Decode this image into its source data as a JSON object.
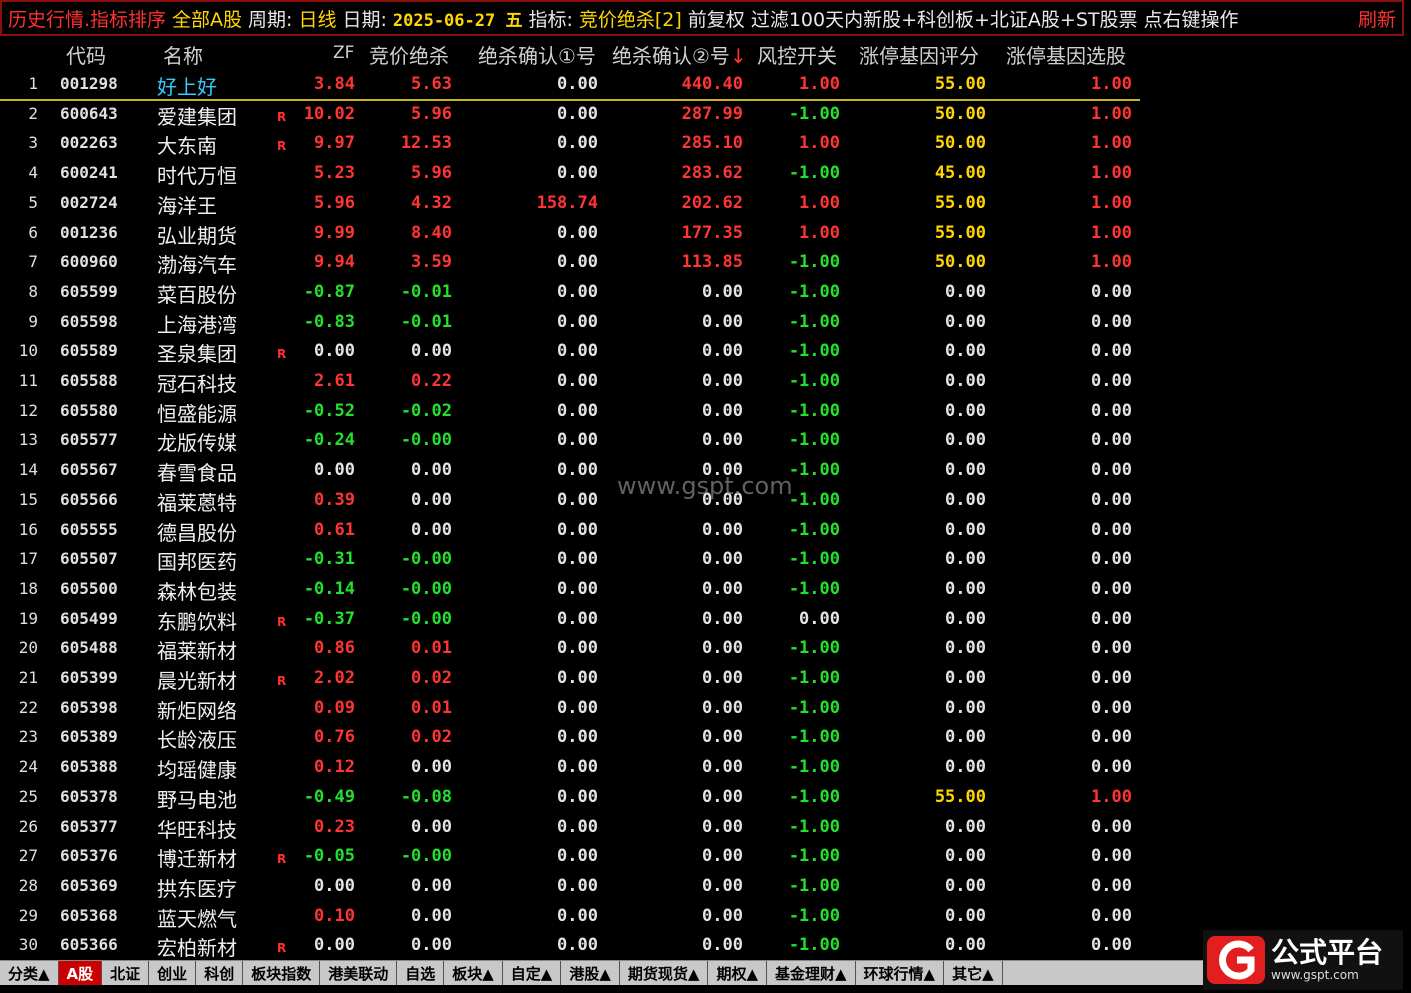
{
  "title": {
    "app": "历史行情.指标排序",
    "market": "全部A股",
    "period_label": "周期:",
    "period_value": "日线",
    "date_label": "日期:",
    "date_value": "2025-06-27 五",
    "indicator_label": "指标:",
    "indicator_value": "竞价绝杀[2]",
    "adjust": "前复权",
    "filter": "过滤100天内新股+科创板+北证A股+ST股票",
    "hint": "点右键操作",
    "refresh": "刷新"
  },
  "columns": {
    "code": "代码",
    "name": "名称",
    "zf": "ZF",
    "jj": "竞价绝杀",
    "q1": "绝杀确认①号",
    "q2": "绝杀确认②号",
    "q2_sort": "↓",
    "fk": "风控开关",
    "pf": "涨停基因评分",
    "xg": "涨停基因选股"
  },
  "rows": [
    {
      "idx": "1",
      "code": "001298",
      "name": "好上好",
      "r": "",
      "zf": "3.84",
      "jj": "5.63",
      "q1": "0.00",
      "q2": "440.40",
      "fk": "1.00",
      "pf": "55.00",
      "xg": "1.00"
    },
    {
      "idx": "2",
      "code": "600643",
      "name": "爱建集团",
      "r": "R",
      "zf": "10.02",
      "jj": "5.96",
      "q1": "0.00",
      "q2": "287.99",
      "fk": "-1.00",
      "pf": "50.00",
      "xg": "1.00"
    },
    {
      "idx": "3",
      "code": "002263",
      "name": "大东南",
      "r": "R",
      "zf": "9.97",
      "jj": "12.53",
      "q1": "0.00",
      "q2": "285.10",
      "fk": "1.00",
      "pf": "50.00",
      "xg": "1.00"
    },
    {
      "idx": "4",
      "code": "600241",
      "name": "时代万恒",
      "r": "",
      "zf": "5.23",
      "jj": "5.96",
      "q1": "0.00",
      "q2": "283.62",
      "fk": "-1.00",
      "pf": "45.00",
      "xg": "1.00"
    },
    {
      "idx": "5",
      "code": "002724",
      "name": "海洋王",
      "r": "",
      "zf": "5.96",
      "jj": "4.32",
      "q1": "158.74",
      "q2": "202.62",
      "fk": "1.00",
      "pf": "55.00",
      "xg": "1.00"
    },
    {
      "idx": "6",
      "code": "001236",
      "name": "弘业期货",
      "r": "",
      "zf": "9.99",
      "jj": "8.40",
      "q1": "0.00",
      "q2": "177.35",
      "fk": "1.00",
      "pf": "55.00",
      "xg": "1.00"
    },
    {
      "idx": "7",
      "code": "600960",
      "name": "渤海汽车",
      "r": "",
      "zf": "9.94",
      "jj": "3.59",
      "q1": "0.00",
      "q2": "113.85",
      "fk": "-1.00",
      "pf": "50.00",
      "xg": "1.00"
    },
    {
      "idx": "8",
      "code": "605599",
      "name": "菜百股份",
      "r": "",
      "zf": "-0.87",
      "jj": "-0.01",
      "q1": "0.00",
      "q2": "0.00",
      "fk": "-1.00",
      "pf": "0.00",
      "xg": "0.00"
    },
    {
      "idx": "9",
      "code": "605598",
      "name": "上海港湾",
      "r": "",
      "zf": "-0.83",
      "jj": "-0.01",
      "q1": "0.00",
      "q2": "0.00",
      "fk": "-1.00",
      "pf": "0.00",
      "xg": "0.00"
    },
    {
      "idx": "10",
      "code": "605589",
      "name": "圣泉集团",
      "r": "R",
      "zf": "0.00",
      "jj": "0.00",
      "q1": "0.00",
      "q2": "0.00",
      "fk": "-1.00",
      "pf": "0.00",
      "xg": "0.00"
    },
    {
      "idx": "11",
      "code": "605588",
      "name": "冠石科技",
      "r": "",
      "zf": "2.61",
      "jj": "0.22",
      "q1": "0.00",
      "q2": "0.00",
      "fk": "-1.00",
      "pf": "0.00",
      "xg": "0.00"
    },
    {
      "idx": "12",
      "code": "605580",
      "name": "恒盛能源",
      "r": "",
      "zf": "-0.52",
      "jj": "-0.02",
      "q1": "0.00",
      "q2": "0.00",
      "fk": "-1.00",
      "pf": "0.00",
      "xg": "0.00"
    },
    {
      "idx": "13",
      "code": "605577",
      "name": "龙版传媒",
      "r": "",
      "zf": "-0.24",
      "jj": "-0.00",
      "q1": "0.00",
      "q2": "0.00",
      "fk": "-1.00",
      "pf": "0.00",
      "xg": "0.00"
    },
    {
      "idx": "14",
      "code": "605567",
      "name": "春雪食品",
      "r": "",
      "zf": "0.00",
      "jj": "0.00",
      "q1": "0.00",
      "q2": "0.00",
      "fk": "-1.00",
      "pf": "0.00",
      "xg": "0.00"
    },
    {
      "idx": "15",
      "code": "605566",
      "name": "福莱蒽特",
      "r": "",
      "zf": "0.39",
      "jj": "0.00",
      "q1": "0.00",
      "q2": "0.00",
      "fk": "-1.00",
      "pf": "0.00",
      "xg": "0.00"
    },
    {
      "idx": "16",
      "code": "605555",
      "name": "德昌股份",
      "r": "",
      "zf": "0.61",
      "jj": "0.00",
      "q1": "0.00",
      "q2": "0.00",
      "fk": "-1.00",
      "pf": "0.00",
      "xg": "0.00"
    },
    {
      "idx": "17",
      "code": "605507",
      "name": "国邦医药",
      "r": "",
      "zf": "-0.31",
      "jj": "-0.00",
      "q1": "0.00",
      "q2": "0.00",
      "fk": "-1.00",
      "pf": "0.00",
      "xg": "0.00"
    },
    {
      "idx": "18",
      "code": "605500",
      "name": "森林包装",
      "r": "",
      "zf": "-0.14",
      "jj": "-0.00",
      "q1": "0.00",
      "q2": "0.00",
      "fk": "-1.00",
      "pf": "0.00",
      "xg": "0.00"
    },
    {
      "idx": "19",
      "code": "605499",
      "name": "东鹏饮料",
      "r": "R",
      "zf": "-0.37",
      "jj": "-0.00",
      "q1": "0.00",
      "q2": "0.00",
      "fk": "0.00",
      "pf": "0.00",
      "xg": "0.00"
    },
    {
      "idx": "20",
      "code": "605488",
      "name": "福莱新材",
      "r": "",
      "zf": "0.86",
      "jj": "0.01",
      "q1": "0.00",
      "q2": "0.00",
      "fk": "-1.00",
      "pf": "0.00",
      "xg": "0.00"
    },
    {
      "idx": "21",
      "code": "605399",
      "name": "晨光新材",
      "r": "R",
      "zf": "2.02",
      "jj": "0.02",
      "q1": "0.00",
      "q2": "0.00",
      "fk": "-1.00",
      "pf": "0.00",
      "xg": "0.00"
    },
    {
      "idx": "22",
      "code": "605398",
      "name": "新炬网络",
      "r": "",
      "zf": "0.09",
      "jj": "0.01",
      "q1": "0.00",
      "q2": "0.00",
      "fk": "-1.00",
      "pf": "0.00",
      "xg": "0.00"
    },
    {
      "idx": "23",
      "code": "605389",
      "name": "长龄液压",
      "r": "",
      "zf": "0.76",
      "jj": "0.02",
      "q1": "0.00",
      "q2": "0.00",
      "fk": "-1.00",
      "pf": "0.00",
      "xg": "0.00"
    },
    {
      "idx": "24",
      "code": "605388",
      "name": "均瑶健康",
      "r": "",
      "zf": "0.12",
      "jj": "0.00",
      "q1": "0.00",
      "q2": "0.00",
      "fk": "-1.00",
      "pf": "0.00",
      "xg": "0.00"
    },
    {
      "idx": "25",
      "code": "605378",
      "name": "野马电池",
      "r": "",
      "zf": "-0.49",
      "jj": "-0.08",
      "q1": "0.00",
      "q2": "0.00",
      "fk": "-1.00",
      "pf": "55.00",
      "xg": "1.00"
    },
    {
      "idx": "26",
      "code": "605377",
      "name": "华旺科技",
      "r": "",
      "zf": "0.23",
      "jj": "0.00",
      "q1": "0.00",
      "q2": "0.00",
      "fk": "-1.00",
      "pf": "0.00",
      "xg": "0.00"
    },
    {
      "idx": "27",
      "code": "605376",
      "name": "博迁新材",
      "r": "R",
      "zf": "-0.05",
      "jj": "-0.00",
      "q1": "0.00",
      "q2": "0.00",
      "fk": "-1.00",
      "pf": "0.00",
      "xg": "0.00"
    },
    {
      "idx": "28",
      "code": "605369",
      "name": "拱东医疗",
      "r": "",
      "zf": "0.00",
      "jj": "0.00",
      "q1": "0.00",
      "q2": "0.00",
      "fk": "-1.00",
      "pf": "0.00",
      "xg": "0.00"
    },
    {
      "idx": "29",
      "code": "605368",
      "name": "蓝天燃气",
      "r": "",
      "zf": "0.10",
      "jj": "0.00",
      "q1": "0.00",
      "q2": "0.00",
      "fk": "-1.00",
      "pf": "0.00",
      "xg": "0.00"
    },
    {
      "idx": "30",
      "code": "605366",
      "name": "宏柏新材",
      "r": "R",
      "zf": "0.00",
      "jj": "0.00",
      "q1": "0.00",
      "q2": "0.00",
      "fk": "-1.00",
      "pf": "0.00",
      "xg": "0.00"
    }
  ],
  "watermark": "www.gspt.com",
  "tabs": [
    "分类▲",
    "A股",
    "北证",
    "创业",
    "科创",
    "板块指数",
    "港美联动",
    "自选",
    "板块▲",
    "自定▲",
    "港股▲",
    "期货现货▲",
    "期权▲",
    "基金理财▲",
    "环球行情▲",
    "其它▲"
  ],
  "active_tab": 1,
  "logo": {
    "main": "公式平台",
    "sub": "www.gspt.com"
  },
  "colors": {
    "up": "#ff3434",
    "down": "#23e02c",
    "flat": "#e4e4e4",
    "accent": "#ffd700",
    "selected_name": "#33ccff"
  }
}
